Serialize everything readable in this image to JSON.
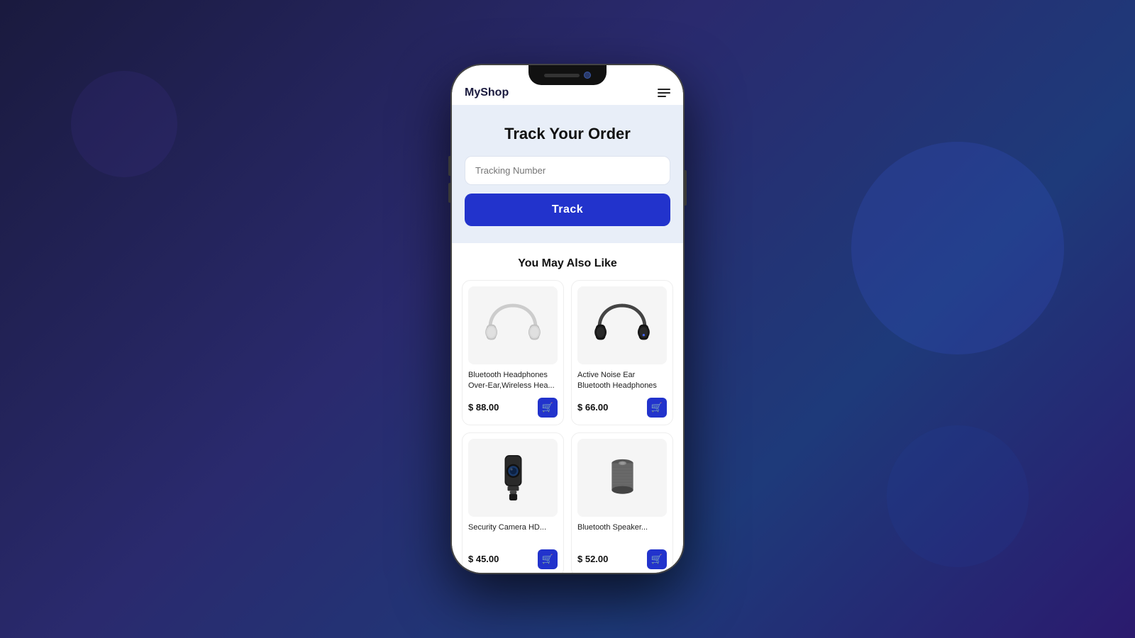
{
  "app": {
    "name": "MyShop"
  },
  "tracking": {
    "title": "Track Your Order",
    "input_placeholder": "Tracking Number",
    "button_label": "Track"
  },
  "recommendations": {
    "title": "You May Also Like",
    "products": [
      {
        "id": 1,
        "name": "Bluetooth Headphones Over-Ear,Wireless Hea...",
        "price": "$ 88.00",
        "color": "white",
        "cart_label": "🛒"
      },
      {
        "id": 2,
        "name": "Active Noise Ear Bluetooth Headphones",
        "price": "$ 66.00",
        "color": "black",
        "cart_label": "🛒"
      },
      {
        "id": 3,
        "name": "Security Camera",
        "price": "$ 45.00",
        "color": "black",
        "cart_label": "🛒"
      },
      {
        "id": 4,
        "name": "Bluetooth Speaker",
        "price": "$ 52.00",
        "color": "gray",
        "cart_label": "🛒"
      }
    ]
  },
  "colors": {
    "primary": "#2233cc",
    "background_track": "#e8eef8",
    "text_dark": "#111111"
  }
}
